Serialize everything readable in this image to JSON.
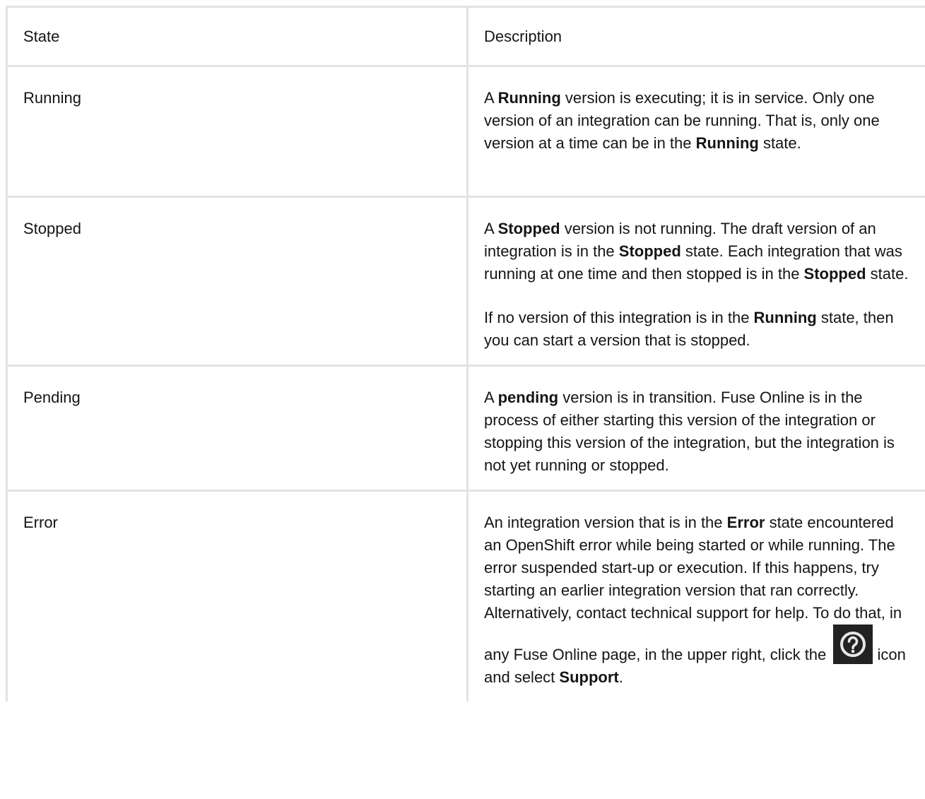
{
  "table": {
    "headers": {
      "state": "State",
      "description": "Description"
    },
    "rows": [
      {
        "state": "Running",
        "desc": {
          "p1": {
            "t1": "A ",
            "b1": "Running",
            "t2": " version is executing; it is in service. Only one version of an integration can be running. That is, only one version at a time can be in the ",
            "b2": "Running",
            "t3": " state."
          }
        }
      },
      {
        "state": "Stopped",
        "desc": {
          "p1": {
            "t1": "A ",
            "b1": "Stopped",
            "t2": " version is not running. The draft version of an integration is in the ",
            "b2": "Stopped",
            "t3": " state. Each integration that was running at one time and then stopped is in the ",
            "b3": "Stopped",
            "t4": " state."
          },
          "p2": {
            "t1": "If no version of this integration is in the ",
            "b1": "Running",
            "t2": " state, then you can start a version that is stopped."
          }
        }
      },
      {
        "state": "Pending",
        "desc": {
          "p1": {
            "t1": "A ",
            "b1": "pending",
            "t2": " version is in transition. Fuse Online is in the process of either starting this version of the integration or stopping this version of the integration, but the integration is not yet running or stopped."
          }
        }
      },
      {
        "state": "Error",
        "desc": {
          "p1": {
            "t1": "An integration version that is in the ",
            "b1": "Error",
            "t2": " state encountered an OpenShift error while being started or while running. The error suspended start-up or execution. If this happens, try starting an earlier integration version that ran correctly. Alternatively, contact technical support for help. To do that, in any Fuse Online page, in the upper right, click the ",
            "icon": "help-question-icon",
            "t3": " icon and select ",
            "b2": "Support",
            "t4": "."
          }
        }
      }
    ]
  }
}
